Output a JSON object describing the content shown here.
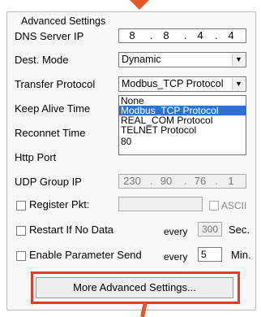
{
  "group": {
    "title": "Advanced Settings"
  },
  "labels": {
    "dns": "DNS Server IP",
    "dest_mode": "Dest. Mode",
    "transfer_protocol": "Transfer Protocol",
    "keep_alive": "Keep Alive Time",
    "reconnect": "Reconnet Time",
    "http_port": "Http Port",
    "udp_group": "UDP Group IP",
    "register_pkt": "Register Pkt:",
    "restart_if_no_data": "Restart If No Data",
    "enable_param_send": "Enable Parameter Send",
    "every1": "every",
    "every2": "every",
    "sec": "Sec.",
    "min": "Min.",
    "ascii": "ASCII"
  },
  "dns": {
    "o1": "8",
    "o2": "8",
    "o3": "4",
    "o4": "4"
  },
  "dest_mode": {
    "value": "Dynamic"
  },
  "protocol": {
    "value": "Modbus_TCP Protocol",
    "options": [
      "None",
      "Modbus_TCP Protocol",
      "REAL_COM Protocol",
      "TELNET Protocol"
    ],
    "selected_index": 1
  },
  "http_port": {
    "value": "80"
  },
  "udp_group": {
    "o1": "230",
    "o2": "90",
    "o3": "76",
    "o4": "1"
  },
  "restart": {
    "value": "300"
  },
  "param_send": {
    "value": "5"
  },
  "buttons": {
    "more_advanced": "More Advanced Settings..."
  },
  "icons": {
    "dropdown": "chevron-down-icon",
    "checkbox": "checkbox-icon"
  },
  "colors": {
    "highlight": "#e23b2b",
    "arrow": "#e2582a",
    "selected": "#2f73c9"
  }
}
